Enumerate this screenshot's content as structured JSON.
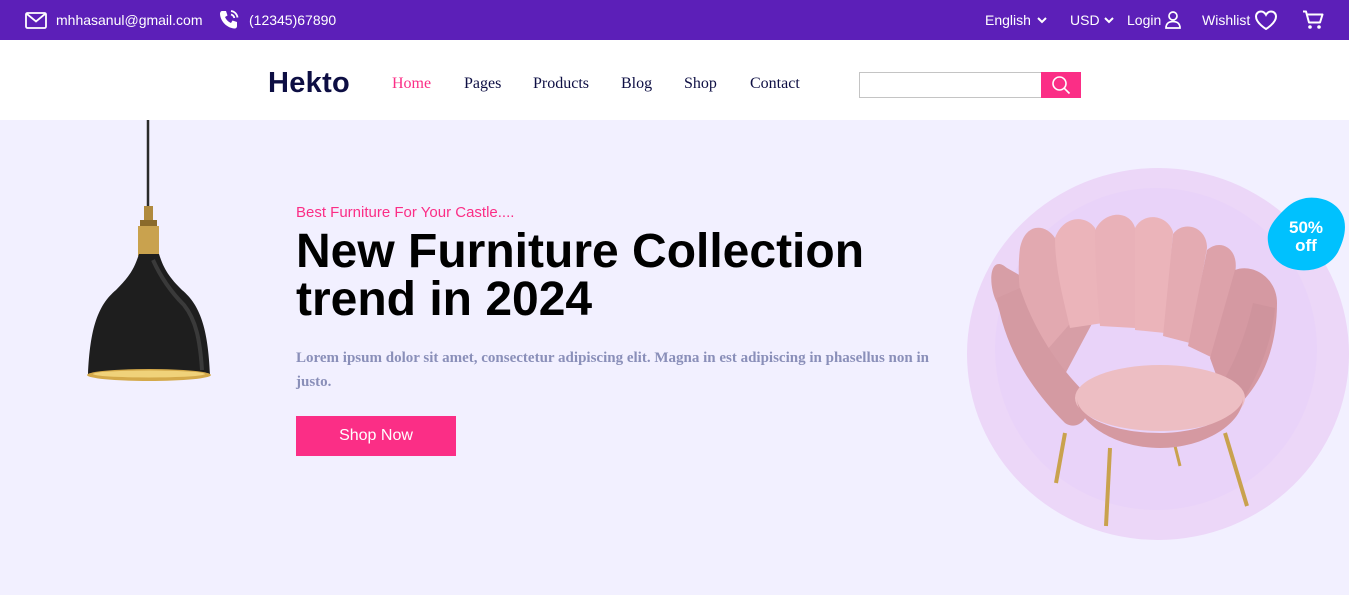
{
  "topbar": {
    "email": "mhhasanul@gmail.com",
    "phone": "(12345)67890",
    "language": "English",
    "currency": "USD",
    "login": "Login",
    "wishlist": "Wishlist"
  },
  "nav": {
    "logo": "Hekto",
    "links": [
      "Home",
      "Pages",
      "Products",
      "Blog",
      "Shop",
      "Contact"
    ],
    "active": "Home",
    "search_value": ""
  },
  "hero": {
    "eyebrow": "Best Furniture For Your Castle....",
    "headline_line1": "New Furniture Collection",
    "headline_line2": "trend in 2024",
    "description": "Lorem ipsum dolor sit amet, consectetur adipiscing elit. Magna in est adipiscing in phasellus non in justo.",
    "button": "Shop Now",
    "badge_line1": "50%",
    "badge_line2": "off"
  },
  "colors": {
    "topbar_bg": "#5C1FB8",
    "accent_pink": "#FB2E86",
    "navy": "#0D0E43",
    "hero_bg": "#F2F0FF",
    "badge_blue": "#00C1FE"
  },
  "icons": [
    "mail-icon",
    "phone-icon",
    "chevron-down-icon",
    "user-icon",
    "heart-icon",
    "cart-icon",
    "search-icon"
  ]
}
